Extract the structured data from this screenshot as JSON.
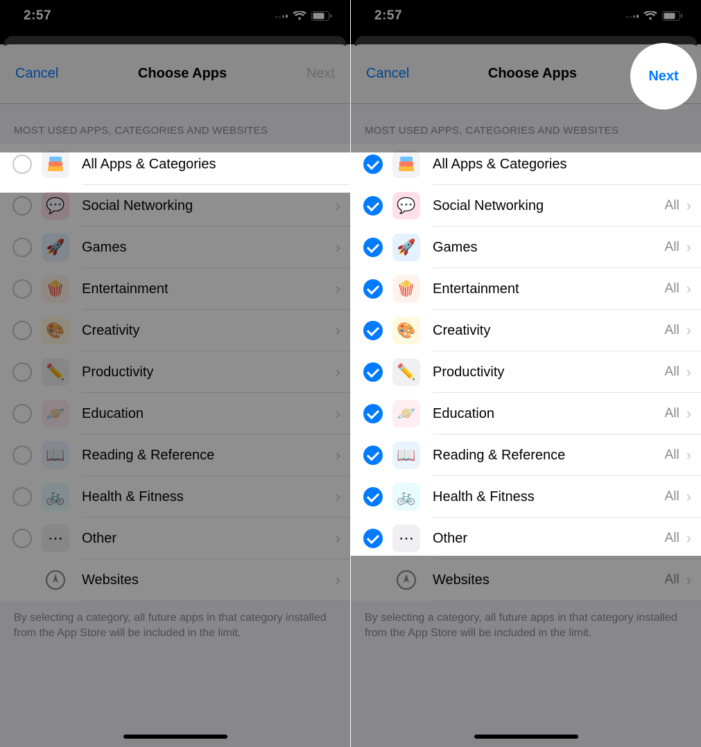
{
  "status": {
    "time": "2:57"
  },
  "nav": {
    "cancel": "Cancel",
    "title": "Choose Apps",
    "next": "Next"
  },
  "section_header": "MOST USED APPS, CATEGORIES AND WEBSITES",
  "all_label": "All Apps & Categories",
  "trailing_all": "All",
  "categories": [
    {
      "key": "social",
      "label": "Social Networking",
      "emoji": "💬",
      "bg": "#ffe0ea"
    },
    {
      "key": "games",
      "label": "Games",
      "emoji": "🚀",
      "bg": "#e4f1ff"
    },
    {
      "key": "entertainment",
      "label": "Entertainment",
      "emoji": "🍿",
      "bg": "#fff2ec"
    },
    {
      "key": "creativity",
      "label": "Creativity",
      "emoji": "🎨",
      "bg": "#fff9e0"
    },
    {
      "key": "productivity",
      "label": "Productivity",
      "emoji": "✏️",
      "bg": "#f0f0f2"
    },
    {
      "key": "education",
      "label": "Education",
      "emoji": "🪐",
      "bg": "#ffeef2"
    },
    {
      "key": "reading",
      "label": "Reading & Reference",
      "emoji": "📖",
      "bg": "#e9f4ff"
    },
    {
      "key": "health",
      "label": "Health & Fitness",
      "emoji": "🚲",
      "bg": "#e8fbff"
    },
    {
      "key": "other",
      "label": "Other",
      "emoji": "⋯",
      "bg": "#f0f0f2"
    }
  ],
  "websites_label": "Websites",
  "footer": "By selecting a category, all future apps in that category installed from the App Store will be included in the limit.",
  "left_state": {
    "all_checked": false,
    "show_all_trailing": false,
    "next_enabled": false
  },
  "right_state": {
    "all_checked": true,
    "show_all_trailing": true,
    "next_enabled": true
  }
}
